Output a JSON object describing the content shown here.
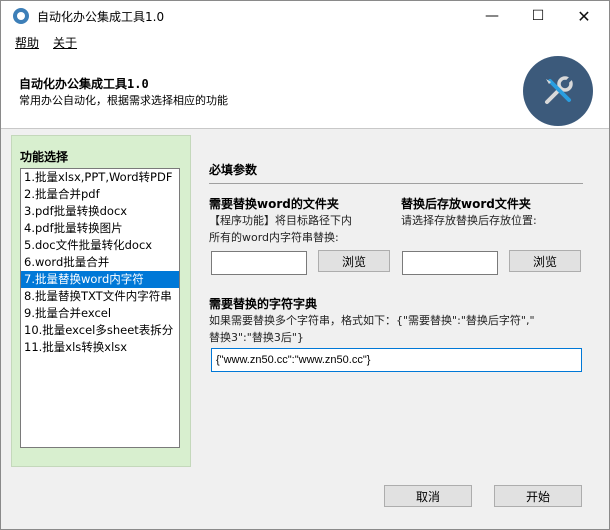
{
  "window": {
    "title": "自动化办公集成工具1.0",
    "minimize": "—",
    "maximize": "☐",
    "close": "✕"
  },
  "menu": {
    "help": "帮助",
    "about": "关于"
  },
  "header": {
    "title": "自动化办公集成工具1.0",
    "subtitle": "常用办公自动化，根据需求选择相应的功能",
    "logo_icon": "tools-icon"
  },
  "sidebar": {
    "title": "功能选择",
    "items": [
      "1.批量xlsx,PPT,Word转PDF",
      "2.批量合并pdf",
      "3.pdf批量转换docx",
      "4.pdf批量转换图片",
      "5.doc文件批量转化docx",
      "6.word批量合并",
      "7.批量替换word内字符",
      "8.批量替换TXT文件内字符串",
      "9.批量合并excel",
      "10.批量excel多sheet表拆分",
      "11.批量xls转换xlsx"
    ],
    "selected_index": 6
  },
  "form": {
    "section_title": "必填参数",
    "left_label": "需要替换word的文件夹",
    "left_desc1": "【程序功能】将目标路径下内",
    "left_desc2": "所有的word内字符串替换:",
    "left_input_value": "",
    "left_browse": "浏览",
    "right_label": "替换后存放word文件夹",
    "right_desc": "请选择存放替换后存放位置:",
    "right_input_value": "",
    "right_browse": "浏览",
    "dict_label": "需要替换的字符字典",
    "dict_desc1": "如果需要替换多个字符串，格式如下：{\"需要替换\":\"替换后字符\",\"",
    "dict_desc2": "替换3\":\"替换3后\"}",
    "dict_value": "{\"www.zn50.cc\":\"www.zn50.cc\"}"
  },
  "footer": {
    "cancel": "取消",
    "start": "开始"
  }
}
